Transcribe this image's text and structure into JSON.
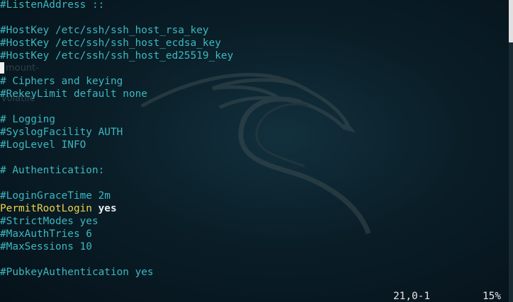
{
  "editor": {
    "lines": [
      {
        "text": "#ListenAddress ::",
        "kind": "comment"
      },
      {
        "text": "",
        "kind": "blank"
      },
      {
        "text": "#HostKey /etc/ssh/ssh_host_rsa_key",
        "kind": "comment"
      },
      {
        "text": "#HostKey /etc/ssh/ssh_host_ecdsa_key",
        "kind": "comment"
      },
      {
        "text": "#HostKey /etc/ssh/ssh_host_ed25519_key",
        "kind": "comment"
      },
      {
        "text": "",
        "kind": "cursor"
      },
      {
        "text": "# Ciphers and keying",
        "kind": "comment"
      },
      {
        "text": "#RekeyLimit default none",
        "kind": "comment"
      },
      {
        "text": "",
        "kind": "blank"
      },
      {
        "text": "# Logging",
        "kind": "comment"
      },
      {
        "text": "#SyslogFacility AUTH",
        "kind": "comment"
      },
      {
        "text": "#LogLevel INFO",
        "kind": "comment"
      },
      {
        "text": "",
        "kind": "blank"
      },
      {
        "text": "# Authentication:",
        "kind": "comment"
      },
      {
        "text": "",
        "kind": "blank"
      },
      {
        "text": "#LoginGraceTime 2m",
        "kind": "comment"
      },
      {
        "text": "PermitRootLogin",
        "kind": "directive",
        "value": "yes"
      },
      {
        "text": "#StrictModes yes",
        "kind": "comment"
      },
      {
        "text": "#MaxAuthTries 6",
        "kind": "comment"
      },
      {
        "text": "#MaxSessions 10",
        "kind": "comment"
      },
      {
        "text": "",
        "kind": "blank"
      },
      {
        "text": "#PubkeyAuthentication yes",
        "kind": "comment"
      }
    ],
    "ghost_text": {
      "mount": "mount-",
      "partial": "volatile"
    },
    "colors": {
      "comment": "#3cb8c0",
      "directive": "#e8d44d",
      "value": "#e8e8f0",
      "background": "#0a1e28"
    }
  },
  "statusbar": {
    "position": "21,0-1",
    "percent": "15%"
  },
  "background_icon": "kali-dragon-icon"
}
